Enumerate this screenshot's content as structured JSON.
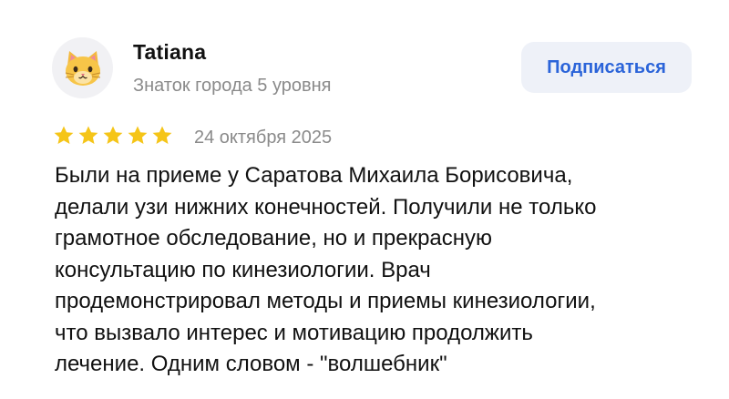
{
  "review": {
    "author": {
      "name": "Tatiana",
      "level": "Знаток города 5 уровня",
      "avatar_icon": "cat-face-icon"
    },
    "subscribe_label": "Подписаться",
    "rating": 5,
    "star_color": "#f5c518",
    "accent_color": "#2b64d9",
    "date": "24 октября 2025",
    "text_lines": [
      "Были на приеме у Саратова Михаила Борисовича,",
      "делали узи нижних конечностей. Получили не только",
      "грамотное обследование, но и прекрасную",
      "консультацию по кинезиологии. Врач",
      "продемонстрировал методы и приемы кинезиологии,",
      "что вызвало интерес и мотивацию продолжить",
      "лечение. Одним словом - \"волшебник\""
    ]
  }
}
